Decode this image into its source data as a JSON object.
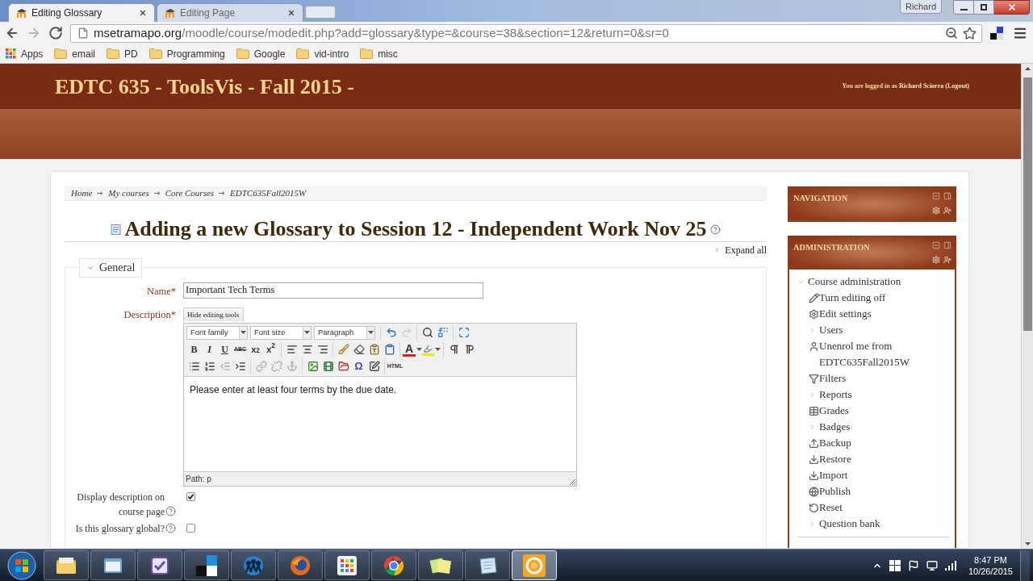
{
  "browser": {
    "tabs": [
      {
        "title": "Editing Glossary",
        "selected": true
      },
      {
        "title": "Editing Page",
        "selected": false
      }
    ],
    "profile": "Richard",
    "nav_buttons": [
      {
        "kind": "back",
        "disabled": false
      },
      {
        "kind": "forward",
        "disabled": true
      },
      {
        "kind": "reload",
        "disabled": false
      }
    ],
    "url": {
      "host": "msetramapo.org",
      "path": "/moodle/course/modedit.php?add=glossary&type=&course=38&section=12&return=0&sr=0"
    },
    "bookmarks": [
      {
        "label": "Apps",
        "kind": "apps"
      },
      {
        "label": "email",
        "kind": "folder"
      },
      {
        "label": "PD",
        "kind": "folder"
      },
      {
        "label": "Programming",
        "kind": "folder"
      },
      {
        "label": "Google",
        "kind": "folder"
      },
      {
        "label": "vid-intro",
        "kind": "folder"
      },
      {
        "label": "misc",
        "kind": "folder"
      }
    ]
  },
  "header": {
    "site_title": "EDTC 635 - ToolsVis - Fall 2015 -",
    "login_text": "You are logged in as",
    "user": "Richard Sciorra",
    "logout": "(Logout)"
  },
  "breadcrumb": [
    "Home",
    "My courses",
    "Core Courses",
    "EDTC635Fall2015W"
  ],
  "page_title": {
    "text": "Adding a new Glossary to Session 12 - Independent Work Nov 25",
    "help": true
  },
  "expand_all": "Expand all",
  "section": {
    "legend": "General",
    "expanded": true
  },
  "name_field": {
    "label": "Name*",
    "value": "Important Tech Terms"
  },
  "description": {
    "label": "Description*",
    "toggle": "Hide editing tools",
    "toolbar": [
      [
        [
          {
            "kind": "select",
            "label": "Font family",
            "disabled": false
          },
          {
            "kind": "select",
            "label": "Font size",
            "disabled": false
          },
          {
            "kind": "select",
            "label": "Paragraph",
            "disabled": false
          }
        ],
        [
          {
            "kind": "undo",
            "disabled": false
          },
          {
            "kind": "redo",
            "disabled": true
          }
        ],
        [
          {
            "kind": "find",
            "disabled": false
          },
          {
            "kind": "replace",
            "disabled": false
          }
        ],
        [
          {
            "kind": "fullscreen",
            "disabled": false
          }
        ]
      ],
      [
        [
          {
            "kind": "bold",
            "text": "B",
            "disabled": false
          },
          {
            "kind": "italic",
            "text": "I",
            "disabled": false
          },
          {
            "kind": "underline",
            "text": "U",
            "disabled": false
          },
          {
            "kind": "strike",
            "text": "ABC",
            "disabled": false
          },
          {
            "kind": "subscript",
            "text": "x$_{2}$",
            "disabled": false
          },
          {
            "kind": "superscript",
            "text": "x$^{2}$",
            "disabled": false
          }
        ],
        [
          {
            "kind": "alignleft",
            "disabled": false
          },
          {
            "kind": "aligncenter",
            "disabled": false
          },
          {
            "kind": "alignright",
            "disabled": false
          }
        ],
        [
          {
            "kind": "cleanup",
            "disabled": false
          },
          {
            "kind": "eraser",
            "disabled": false
          },
          {
            "kind": "pastetext",
            "disabled": false
          },
          {
            "kind": "pasteword",
            "disabled": false
          }
        ],
        [
          {
            "kind": "textcolor",
            "text": "A",
            "disabled": false
          },
          {
            "kind": "highlight",
            "disabled": false
          }
        ],
        [
          {
            "kind": "ltr",
            "disabled": false
          },
          {
            "kind": "rtl",
            "disabled": false
          }
        ]
      ],
      [
        [
          {
            "kind": "bullets",
            "disabled": false
          },
          {
            "kind": "numbers",
            "disabled": false
          },
          {
            "kind": "outdent",
            "disabled": true
          },
          {
            "kind": "indent",
            "disabled": false
          }
        ],
        [
          {
            "kind": "link",
            "disabled": true
          },
          {
            "kind": "unlink",
            "disabled": true
          },
          {
            "kind": "anchor",
            "disabled": true
          }
        ],
        [
          {
            "kind": "image",
            "disabled": false
          },
          {
            "kind": "media",
            "disabled": false
          },
          {
            "kind": "files",
            "disabled": false
          },
          {
            "kind": "specialchar",
            "text": "Ω",
            "disabled": false
          },
          {
            "kind": "edit",
            "disabled": false
          }
        ],
        [
          {
            "kind": "html",
            "text": "HTML",
            "disabled": false
          }
        ]
      ]
    ],
    "text": "Please enter at least four terms by the due date.",
    "path": "Path: p"
  },
  "options": [
    {
      "label": "Display description on course page",
      "checked": true,
      "help": true
    },
    {
      "label": "Is this glossary global?",
      "checked": false,
      "help": true
    }
  ],
  "blocks": [
    {
      "title": "NAVIGATION"
    },
    {
      "title": "ADMINISTRATION",
      "items": [
        {
          "label": "Course administration",
          "kind": "branch",
          "expanded": true,
          "children": [
            {
              "label": "Turn editing off",
              "kind": "pencil"
            },
            {
              "label": "Edit settings",
              "kind": "gear"
            },
            {
              "label": "Users",
              "kind": "branch",
              "expanded": false
            },
            {
              "label": "Unenrol me from EDTC635Fall2015W",
              "kind": "user"
            },
            {
              "label": "Filters",
              "kind": "filter"
            },
            {
              "label": "Reports",
              "kind": "branch",
              "expanded": false
            },
            {
              "label": "Grades",
              "kind": "table"
            },
            {
              "label": "Badges",
              "kind": "branch",
              "expanded": false
            },
            {
              "label": "Backup",
              "kind": "upload"
            },
            {
              "label": "Restore",
              "kind": "download"
            },
            {
              "label": "Import",
              "kind": "download"
            },
            {
              "label": "Publish",
              "kind": "globe"
            },
            {
              "label": "Reset",
              "kind": "reset"
            },
            {
              "label": "Question bank",
              "kind": "branch",
              "expanded": false
            }
          ]
        }
      ]
    }
  ],
  "taskbar": {
    "apps": [
      {
        "kind": "folders",
        "selected": false
      },
      {
        "kind": "window",
        "selected": false
      },
      {
        "kind": "checklist",
        "selected": false
      },
      {
        "kind": "tiles",
        "selected": false
      },
      {
        "kind": "people",
        "selected": false
      },
      {
        "kind": "orangeglobe",
        "selected": false
      },
      {
        "kind": "grid",
        "selected": false
      },
      {
        "kind": "colorring",
        "selected": false
      },
      {
        "kind": "notes",
        "selected": false
      },
      {
        "kind": "notepad",
        "selected": false
      },
      {
        "kind": "orangering",
        "selected": true
      }
    ],
    "time": "8:47 PM",
    "date": "10/26/2015"
  }
}
